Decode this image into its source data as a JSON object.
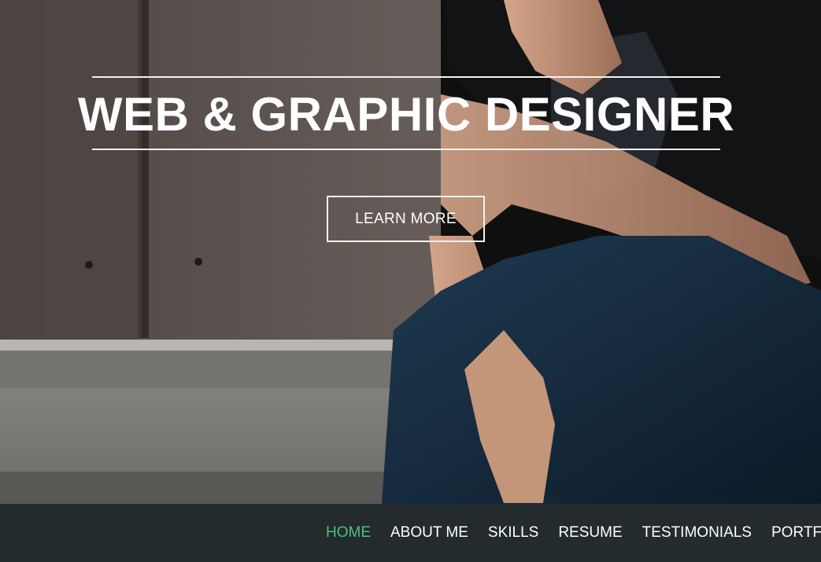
{
  "hero": {
    "headline": "WEB & GRAPHIC DESIGNER",
    "cta_label": "LEARN MORE"
  },
  "nav": {
    "items": [
      {
        "label": "HOME",
        "active": true
      },
      {
        "label": "ABOUT ME",
        "active": false
      },
      {
        "label": "SKILLS",
        "active": false
      },
      {
        "label": "RESUME",
        "active": false
      },
      {
        "label": "TESTIMONIALS",
        "active": false
      },
      {
        "label": "PORTFOLIO",
        "active": false
      }
    ]
  },
  "colors": {
    "accent": "#4ec07e",
    "navbar_bg": "#232b2e",
    "text": "#ffffff"
  }
}
